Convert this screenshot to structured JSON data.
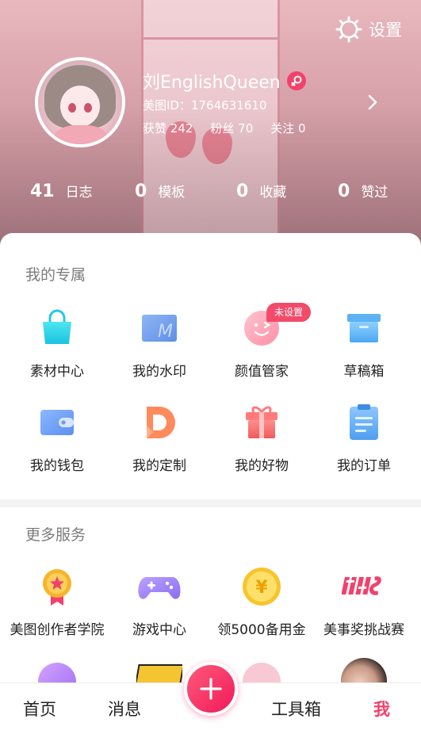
{
  "header": {
    "settings_label": "设置",
    "username": "刘EnglishQueen",
    "meitu_id": "美图ID：1764631610",
    "likes": "获赞 242",
    "fans": "粉丝 70",
    "following": "关注 0",
    "counts": [
      {
        "num": "41",
        "label": "日志"
      },
      {
        "num": "0",
        "label": "模板"
      },
      {
        "num": "0",
        "label": "收藏"
      },
      {
        "num": "0",
        "label": "赞过"
      }
    ]
  },
  "exclusive": {
    "title": "我的专属",
    "items": [
      {
        "label": "素材中心",
        "icon": "shopping-bag-icon"
      },
      {
        "label": "我的水印",
        "icon": "watermark-icon"
      },
      {
        "label": "颜值管家",
        "icon": "smiley-face-icon"
      },
      {
        "label": "草稿箱",
        "icon": "draft-box-icon"
      },
      {
        "label": "我的钱包",
        "icon": "wallet-icon"
      },
      {
        "label": "我的定制",
        "icon": "custom-d-icon"
      },
      {
        "label": "我的好物",
        "icon": "gift-icon"
      },
      {
        "label": "我的订单",
        "icon": "clipboard-icon"
      }
    ],
    "unset_badge": "未设置"
  },
  "services": {
    "title": "更多服务",
    "items": [
      {
        "label": "美图创作者学院",
        "icon": "medal-icon"
      },
      {
        "label": "游戏中心",
        "icon": "gamepad-icon"
      },
      {
        "label": "领5000备用金",
        "icon": "yuan-coin-icon"
      },
      {
        "label": "美事奖挑战赛",
        "icon": "challenge-logo-icon"
      }
    ]
  },
  "bottom_nav": {
    "home": "首页",
    "messages": "消息",
    "toolbox": "工具箱",
    "me": "我"
  },
  "colors": {
    "accent": "#f2416c",
    "panel_bg": "#ffffff",
    "section_title": "#7c7c7c"
  }
}
